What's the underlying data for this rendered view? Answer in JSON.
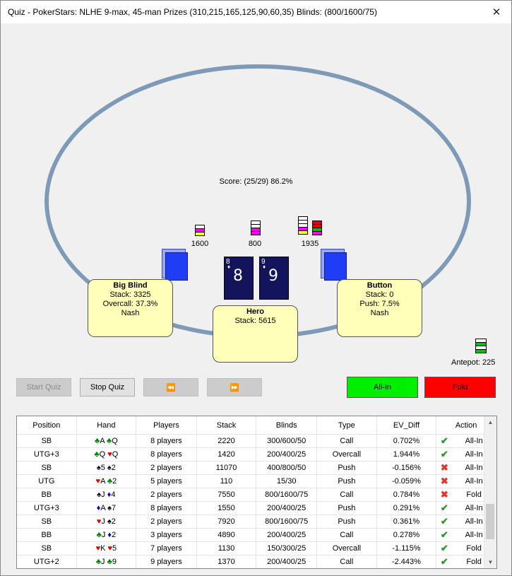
{
  "window": {
    "title": "Quiz - PokerStars: NLHE 9-max, 45-man Prizes (310,215,165,125,90,60,35) Blinds: (800/1600/75)",
    "close_glyph": "✕"
  },
  "table": {
    "score": "Score: (25/29) 86.2%",
    "bets": {
      "bb": "1600",
      "hero": "800",
      "button": "1935"
    },
    "antepot": "Antepot: 225"
  },
  "hero_cards": [
    {
      "rank": "8",
      "suit": "♦"
    },
    {
      "rank": "9",
      "suit": "♦"
    }
  ],
  "seats": {
    "big_blind": {
      "name": "Big Blind",
      "line1": "Stack: 3325",
      "line2": "Overcall: 37.3%",
      "line3": "Nash"
    },
    "hero": {
      "name": "Hero",
      "line1": "Stack: 5615"
    },
    "button": {
      "name": "Button",
      "line1": "Stack: 0",
      "line2": "Push: 7.5%",
      "line3": "Nash"
    }
  },
  "controls": {
    "start_quiz": "Start Quiz",
    "stop_quiz": "Stop Quiz",
    "prev": "⏪",
    "next": "⏩",
    "all_in": "All-In",
    "fold": "Fold"
  },
  "grid": {
    "columns": [
      "Position",
      "Hand",
      "Players",
      "Stack",
      "Blinds",
      "Type",
      "EV_Diff",
      "Action"
    ],
    "rows": [
      {
        "position": "SB",
        "hand": [
          [
            "♣",
            "A"
          ],
          [
            "♣",
            "Q"
          ]
        ],
        "players": "8 players",
        "stack": "2220",
        "blinds": "300/600/50",
        "type": "Call",
        "ev": "0.702%",
        "ok": true,
        "action": "All-In"
      },
      {
        "position": "UTG+3",
        "hand": [
          [
            "♣",
            "Q"
          ],
          [
            "♥",
            "Q"
          ]
        ],
        "players": "8 players",
        "stack": "1420",
        "blinds": "200/400/25",
        "type": "Overcall",
        "ev": "1.944%",
        "ok": true,
        "action": "All-In"
      },
      {
        "position": "SB",
        "hand": [
          [
            "♠",
            "5"
          ],
          [
            "♠",
            "2"
          ]
        ],
        "players": "2 players",
        "stack": "11070",
        "blinds": "400/800/50",
        "type": "Push",
        "ev": "-0.156%",
        "ok": false,
        "action": "All-In"
      },
      {
        "position": "UTG",
        "hand": [
          [
            "♥",
            "A"
          ],
          [
            "♣",
            "2"
          ]
        ],
        "players": "5 players",
        "stack": "110",
        "blinds": "15/30",
        "type": "Push",
        "ev": "-0.059%",
        "ok": false,
        "action": "All-In"
      },
      {
        "position": "BB",
        "hand": [
          [
            "♠",
            "J"
          ],
          [
            "♦",
            "4"
          ]
        ],
        "players": "2 players",
        "stack": "7550",
        "blinds": "800/1600/75",
        "type": "Call",
        "ev": "0.784%",
        "ok": false,
        "action": "Fold"
      },
      {
        "position": "UTG+3",
        "hand": [
          [
            "♦",
            "A"
          ],
          [
            "♠",
            "7"
          ]
        ],
        "players": "8 players",
        "stack": "1550",
        "blinds": "200/400/25",
        "type": "Push",
        "ev": "0.291%",
        "ok": true,
        "action": "All-In"
      },
      {
        "position": "SB",
        "hand": [
          [
            "♥",
            "J"
          ],
          [
            "♠",
            "2"
          ]
        ],
        "players": "2 players",
        "stack": "7920",
        "blinds": "800/1600/75",
        "type": "Push",
        "ev": "0.361%",
        "ok": true,
        "action": "All-In"
      },
      {
        "position": "BB",
        "hand": [
          [
            "♣",
            "J"
          ],
          [
            "♦",
            "2"
          ]
        ],
        "players": "3 players",
        "stack": "4890",
        "blinds": "200/400/25",
        "type": "Call",
        "ev": "0.278%",
        "ok": true,
        "action": "All-In"
      },
      {
        "position": "SB",
        "hand": [
          [
            "♥",
            "K"
          ],
          [
            "♥",
            "5"
          ]
        ],
        "players": "7 players",
        "stack": "1130",
        "blinds": "150/300/25",
        "type": "Overcall",
        "ev": "-1.115%",
        "ok": true,
        "action": "Fold"
      },
      {
        "position": "UTG+2",
        "hand": [
          [
            "♣",
            "J"
          ],
          [
            "♣",
            "9"
          ]
        ],
        "players": "9 players",
        "stack": "1370",
        "blinds": "200/400/25",
        "type": "Call",
        "ev": "-2.443%",
        "ok": true,
        "action": "Fold"
      }
    ]
  }
}
